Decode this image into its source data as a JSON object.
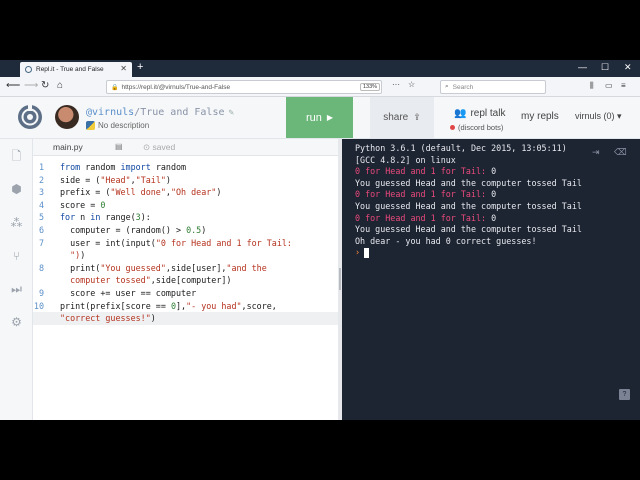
{
  "browser": {
    "tab_title": "Repl.it - True and False",
    "tab_close": "✕",
    "new_tab": "+",
    "url": "https://repl.it/@virnuls/True-and-False",
    "zoom": "133%",
    "search_placeholder": "Search",
    "window_controls": [
      "—",
      "☐",
      "✕"
    ]
  },
  "header": {
    "username_handle": "@virnuls",
    "project_name": "/True and False",
    "description": "No description",
    "run_label": "run",
    "share_label": "share",
    "repl_talk": "repl talk",
    "discord": "(discord bots)",
    "my_repls": "my repls",
    "user_menu": "virnuls (0)"
  },
  "editor": {
    "file_tab": "main.py",
    "saved_label": "saved",
    "lines": [
      {
        "n": "1",
        "html": "<span class=\"kw\">from</span> random <span class=\"kw\">import</span> random"
      },
      {
        "n": "2",
        "html": "side = (<span class=\"st\">\"Head\"</span>,<span class=\"st\">\"Tail\"</span>)"
      },
      {
        "n": "3",
        "html": "prefix = (<span class=\"st\">\"Well done\"</span>,<span class=\"st\">\"Oh dear\"</span>)"
      },
      {
        "n": "4",
        "html": "score = <span class=\"nm\">0</span>"
      },
      {
        "n": "5",
        "html": "<span class=\"kw\">for</span> n <span class=\"kw\">in</span> range(<span class=\"nm\">3</span>):"
      },
      {
        "n": "6",
        "html": "  computer = (random() &gt; <span class=\"nm\">0.5</span>)"
      },
      {
        "n": "7",
        "html": "  user = int(input(<span class=\"st\">\"0 for Head and 1 for Tail:</span>"
      },
      {
        "n": "",
        "html": "  <span class=\"st\">\")</span>)"
      },
      {
        "n": "8",
        "html": "  print(<span class=\"st\">\"You guessed\"</span>,side[user],<span class=\"st\">\"and the</span>"
      },
      {
        "n": "",
        "html": "  <span class=\"st\">computer tossed\"</span>,side[computer])"
      },
      {
        "n": "9",
        "html": "  score += user == computer"
      },
      {
        "n": "10",
        "html": "print(prefix[score == <span class=\"nm\">0</span>],<span class=\"st\">\"- you had\"</span>,score,"
      },
      {
        "n": "",
        "html": "<span class=\"st\">\"correct guesses!\"</span>)"
      }
    ]
  },
  "console": {
    "lines": [
      {
        "kind": "plain",
        "text": "Python 3.6.1 (default, Dec 2015, 13:05:11)"
      },
      {
        "kind": "plain",
        "text": "[GCC 4.8.2] on linux"
      },
      {
        "kind": "prompt",
        "prompt": "0 for Head and 1 for Tail:",
        "answer": " 0"
      },
      {
        "kind": "plain",
        "text": "You guessed Head and the computer tossed Tail"
      },
      {
        "kind": "prompt",
        "prompt": "0 for Head and 1 for Tail:",
        "answer": " 0"
      },
      {
        "kind": "plain",
        "text": "You guessed Head and the computer tossed Tail"
      },
      {
        "kind": "prompt",
        "prompt": "0 for Head and 1 for Tail:",
        "answer": " 0"
      },
      {
        "kind": "plain",
        "text": "You guessed Head and the computer tossed Tail"
      },
      {
        "kind": "plain",
        "text": "Oh dear - you had 0 correct guesses!"
      }
    ],
    "prompt_symbol": "›",
    "help": "?"
  }
}
